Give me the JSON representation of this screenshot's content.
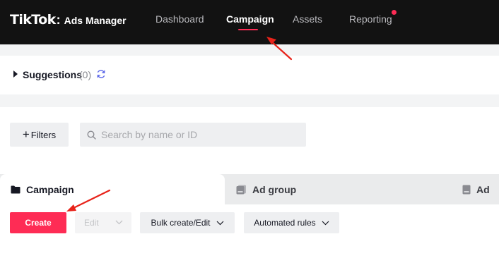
{
  "header": {
    "brand_name": "TikTok",
    "brand_suffix": "Ads Manager",
    "nav": [
      {
        "label": "Dashboard",
        "active": false
      },
      {
        "label": "Campaign",
        "active": true
      },
      {
        "label": "Assets",
        "active": false
      },
      {
        "label": "Reporting",
        "active": false,
        "has_notification_dot": true
      }
    ]
  },
  "suggestions": {
    "label": "Suggestions",
    "count": "(0)"
  },
  "filters": {
    "filters_label": "Filters",
    "search_placeholder": "Search by name or ID"
  },
  "tabs": [
    {
      "label": "Campaign",
      "active": true,
      "icon": "folder-icon"
    },
    {
      "label": "Ad group",
      "active": false,
      "icon": "ad-group-icon"
    },
    {
      "label": "Ad",
      "active": false,
      "icon": "ad-icon"
    }
  ],
  "actions": {
    "create_label": "Create",
    "edit_label": "Edit",
    "bulk_label": "Bulk create/Edit",
    "automated_label": "Automated rules"
  },
  "colors": {
    "accent": "#fe2c55",
    "header_bg": "#121212",
    "annotation_arrow": "#e8231a"
  }
}
